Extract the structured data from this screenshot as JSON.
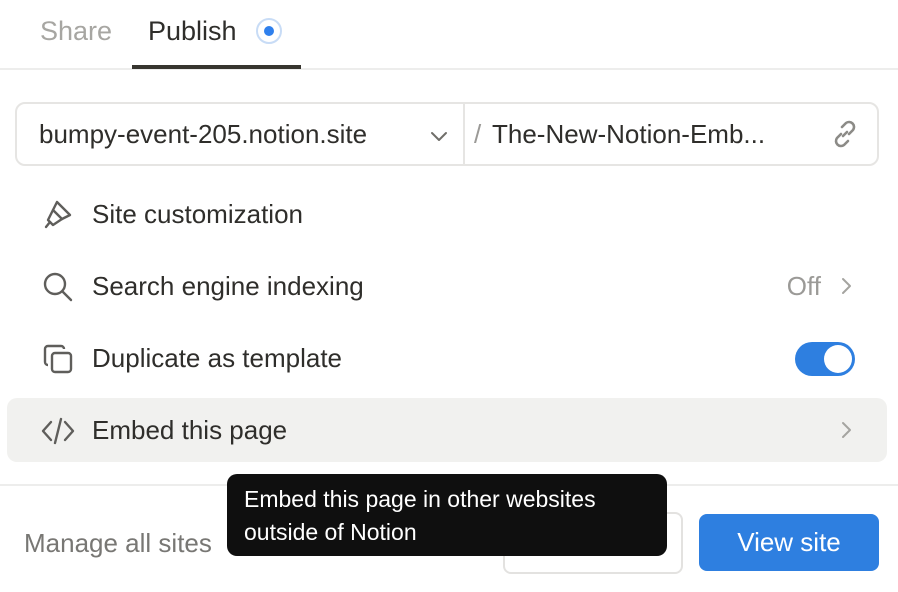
{
  "tabs": {
    "share": "Share",
    "publish": "Publish"
  },
  "url": {
    "domain": "bumpy-event-205.notion.site",
    "slash": "/",
    "slug": "The-New-Notion-Emb..."
  },
  "rows": {
    "site_customization": "Site customization",
    "search_indexing": "Search engine indexing",
    "search_indexing_value": "Off",
    "duplicate_template": "Duplicate as template",
    "duplicate_template_enabled": true,
    "embed_page": "Embed this page"
  },
  "footer": {
    "manage_sites": "Manage all sites",
    "view_site": "View site"
  },
  "tooltip": {
    "line1": "Embed this page in other websites",
    "line2": "outside of Notion"
  },
  "colors": {
    "accent": "#2E7FE0",
    "hover_background": "#F1F1EF",
    "tooltip_background": "#0F0F0F"
  },
  "icons": {
    "publish_status": "publish-status-dot-icon",
    "domain_dropdown": "chevron-down-icon",
    "copy_link": "link-icon",
    "site_customization": "paintbrush-icon",
    "search_indexing": "search-icon",
    "duplicate_template": "duplicate-icon",
    "embed_page": "code-icon",
    "row_navigation": "chevron-right-icon"
  }
}
